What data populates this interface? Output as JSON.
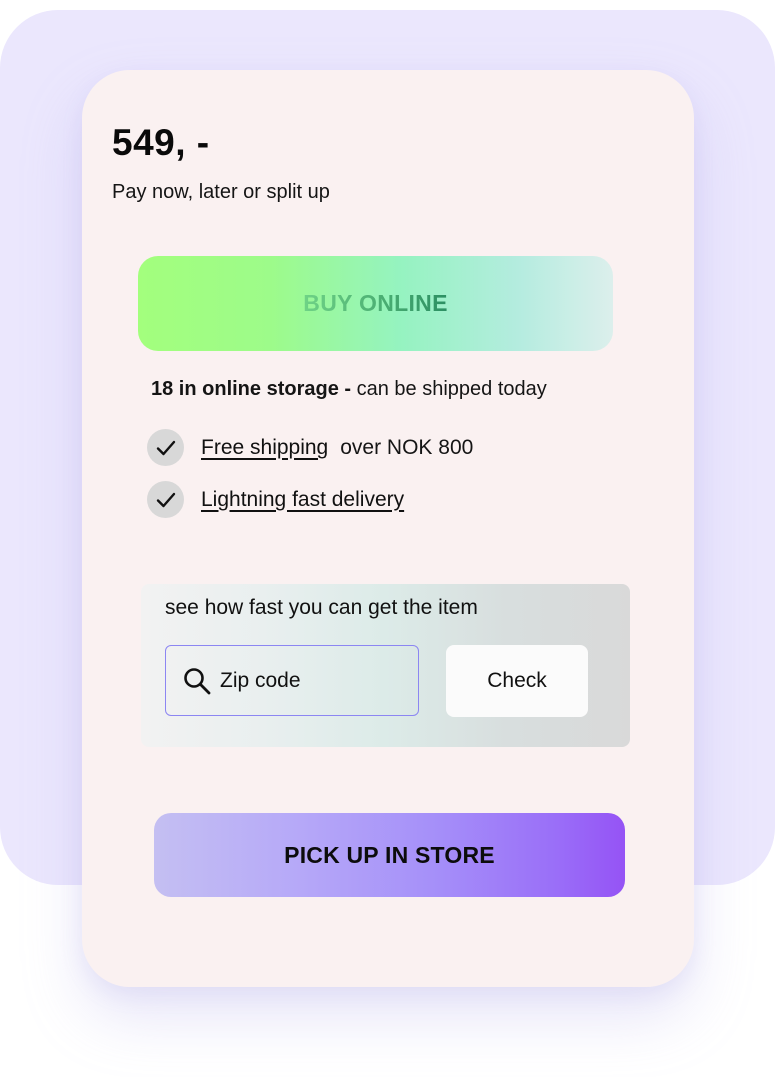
{
  "product": {
    "price": "549, -",
    "payment_note": "Pay now, later or split up"
  },
  "buy_online": {
    "label": "BUY ONLINE"
  },
  "stock": {
    "count_label": "18 in online storage -",
    "shipping_note": "can be shipped today"
  },
  "features": [
    {
      "icon": "checkmark-icon",
      "link": "Free shipping",
      "text": "over NOK 800"
    },
    {
      "icon": "checkmark-icon",
      "link": "Lightning fast delivery",
      "text": ""
    }
  ],
  "zip_check": {
    "title": "see how fast you can get the item",
    "search_icon": "search-icon",
    "input_value": "",
    "input_placeholder": "Zip code",
    "button_label": "Check"
  },
  "pickup": {
    "label": "PICK UP IN STORE"
  },
  "colors": {
    "background_panel": "#ebe7fd",
    "card": "#faf1f1",
    "buy_gradient_start": "#a3ff7d",
    "buy_gradient_end": "#dcefec",
    "pickup_gradient_start": "#c4bff2",
    "pickup_gradient_end": "#9553f5",
    "zip_field_border": "#8c86f2"
  }
}
